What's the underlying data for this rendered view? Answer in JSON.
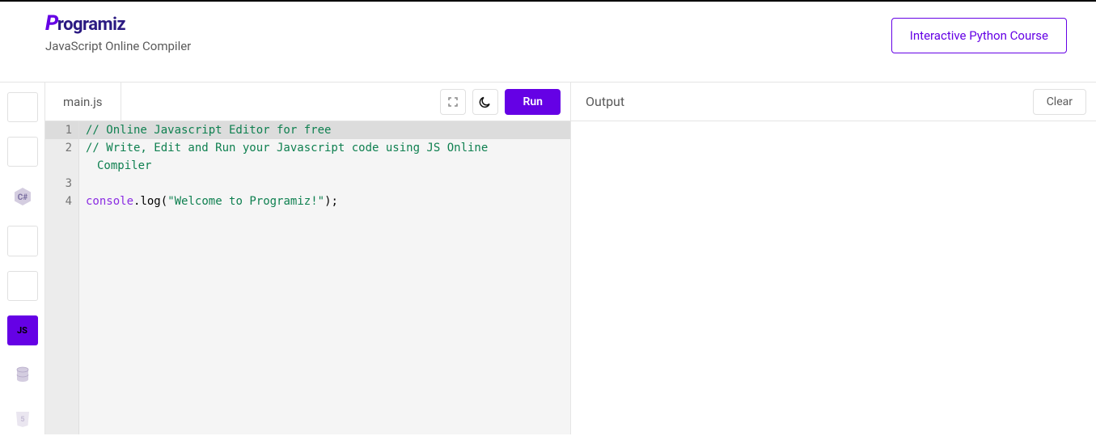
{
  "header": {
    "logo_rest": "rogramiz",
    "subtitle": "JavaScript Online Compiler",
    "course_button": "Interactive Python Course"
  },
  "sidebar": {
    "items": [
      {
        "type": "icon",
        "name": "python-icon"
      },
      {
        "type": "icon",
        "name": "r-icon"
      },
      {
        "type": "icon",
        "name": "csharp-icon"
      },
      {
        "type": "icon",
        "name": "java-icon"
      },
      {
        "type": "icon",
        "name": "c-icon"
      },
      {
        "type": "label",
        "label": "JS",
        "active": true
      },
      {
        "type": "icon",
        "name": "database-icon"
      },
      {
        "type": "icon",
        "name": "html5-icon"
      }
    ]
  },
  "editor": {
    "filename": "main.js",
    "run_label": "Run",
    "lines": {
      "l1": "1",
      "l2": "2",
      "l3": "3",
      "l4": "4"
    },
    "code": {
      "comment1": "// Online Javascript Editor for free",
      "comment2a": "// Write, Edit and Run your Javascript code using JS Online",
      "comment2b": "Compiler",
      "ident": "console",
      "dot": ".",
      "method": "log",
      "open": "(",
      "string": "\"Welcome to Programiz!\"",
      "close": ");"
    }
  },
  "output": {
    "label": "Output",
    "clear_label": "Clear",
    "content": ""
  },
  "colors": {
    "accent": "#6501e5"
  }
}
